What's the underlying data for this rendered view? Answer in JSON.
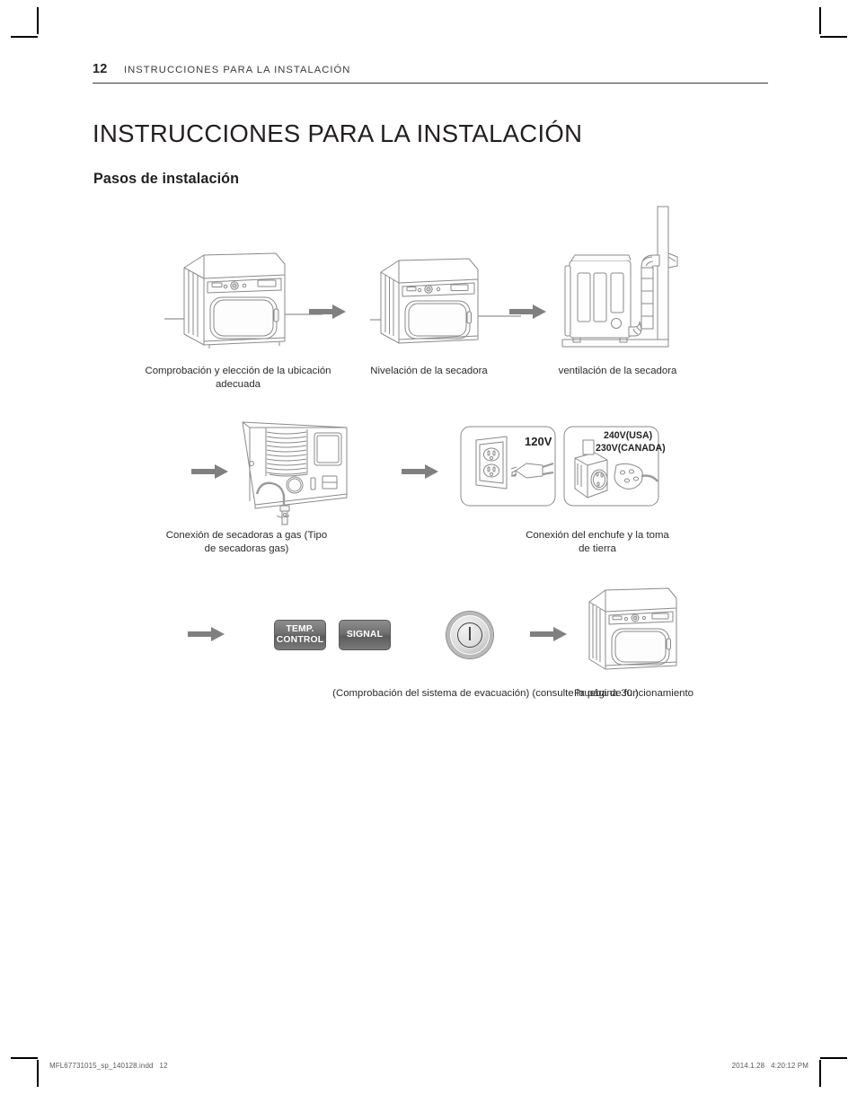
{
  "header": {
    "page_number": "12",
    "title": "INSTRUCCIONES PARA LA INSTALACIÓN"
  },
  "chapter_title": "INSTRUCCIONES PARA LA INSTALACIÓN",
  "section_title": "Pasos de instalación",
  "steps": [
    {
      "id": "location-check",
      "caption": "Comprobación y elección de la ubicación adecuada",
      "figure": "dryer-front-level-line"
    },
    {
      "id": "leveling",
      "caption": "Nivelación de la secadora",
      "figure": "dryer-front-level-line"
    },
    {
      "id": "venting",
      "caption": "ventilación de la secadora",
      "figure": "dryer-rear-vent-duct-wall"
    },
    {
      "id": "gas-connection",
      "caption": "Conexión de secadoras a gas (Tipo de secadoras gas)",
      "figure": "dryer-rear-gas-hose"
    },
    {
      "id": "power-ground",
      "caption": "Conexión del enchufe y la toma de tierra",
      "figure": "outlets-and-plugs"
    },
    {
      "id": "exhaust-check",
      "caption": "(Comprobación del sistema de evacuación) (consulte la página 30.)",
      "figure": "control-panel-buttons"
    },
    {
      "id": "test-run",
      "caption": "Prueba de funcionamiento",
      "figure": "dryer-front"
    }
  ],
  "controls": {
    "temp_control_line1": "TEMP.",
    "temp_control_line2": "CONTROL",
    "signal_label": "SIGNAL",
    "power_icon": "power-icon"
  },
  "outlets": {
    "standard_label": "120V",
    "high_voltage_line1": "240V(USA)",
    "high_voltage_line2": "230V(CANADA)"
  },
  "footer": {
    "file_name": "MFL67731015_sp_140128.indd   12",
    "timestamp": "2014.1.28   4:20:12 PM"
  },
  "colors": {
    "text": "#231f20",
    "arrow": "#808080",
    "line_art": "#8a8a8a",
    "rule": "#3c3c3c"
  }
}
